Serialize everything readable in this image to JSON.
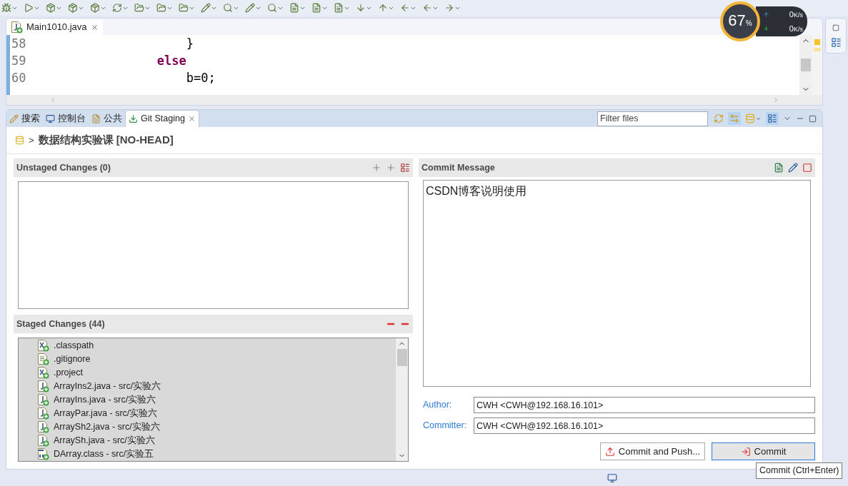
{
  "editor": {
    "tab": {
      "label": "Main1010.java",
      "selected": true
    },
    "lines": [
      {
        "number": "58",
        "text": "                    }",
        "kind": "plain"
      },
      {
        "number": "59",
        "text": "                else",
        "kind": "keyword"
      },
      {
        "number": "60",
        "text": "                    b=0;",
        "kind": "plain"
      }
    ]
  },
  "views": {
    "tabs": [
      {
        "label": "搜索",
        "kind": "search",
        "selected": false
      },
      {
        "label": "控制台",
        "kind": "console",
        "selected": false
      },
      {
        "label": "公共",
        "kind": "common",
        "selected": false
      },
      {
        "label": "Git Staging",
        "kind": "staging",
        "selected": true
      }
    ],
    "filter": {
      "placeholder": "Filter files"
    }
  },
  "repository": {
    "separator": ">",
    "title": "数据结构实验课 [NO-HEAD]"
  },
  "unstaged": {
    "title": "Unstaged Changes (0)"
  },
  "staged": {
    "title": "Staged Changes (44)",
    "files": [
      {
        "name": ".classpath",
        "kind": "xml"
      },
      {
        "name": ".gitignore",
        "kind": "text"
      },
      {
        "name": ".project",
        "kind": "xml"
      },
      {
        "name": "ArrayIns2.java - src/实验六",
        "kind": "java"
      },
      {
        "name": "ArrayIns.java - src/实验六",
        "kind": "java"
      },
      {
        "name": "ArrayPar.java - src/实验六",
        "kind": "java"
      },
      {
        "name": "ArraySh2.java - src/实验六",
        "kind": "java"
      },
      {
        "name": "ArraySh.java - src/实验六",
        "kind": "java"
      },
      {
        "name": "DArray.class - src/实验五",
        "kind": "class"
      }
    ]
  },
  "commit": {
    "title": "Commit Message",
    "message": "CSDN博客说明使用",
    "author_label": "Author:",
    "author": "CWH <CWH@192.168.16.101>",
    "committer_label": "Committer:",
    "committer": "CWH <CWH@192.168.16.101>",
    "buttons": [
      {
        "label": "Commit and Push...",
        "kind": "push"
      },
      {
        "label": "Commit",
        "kind": "commit"
      }
    ],
    "tooltip": "Commit (Ctrl+Enter)"
  },
  "monitor": {
    "percent": "67",
    "percent_unit": "%",
    "upload": "0",
    "upload_unit": "K/s",
    "download": "0",
    "download_unit": "K/s"
  }
}
